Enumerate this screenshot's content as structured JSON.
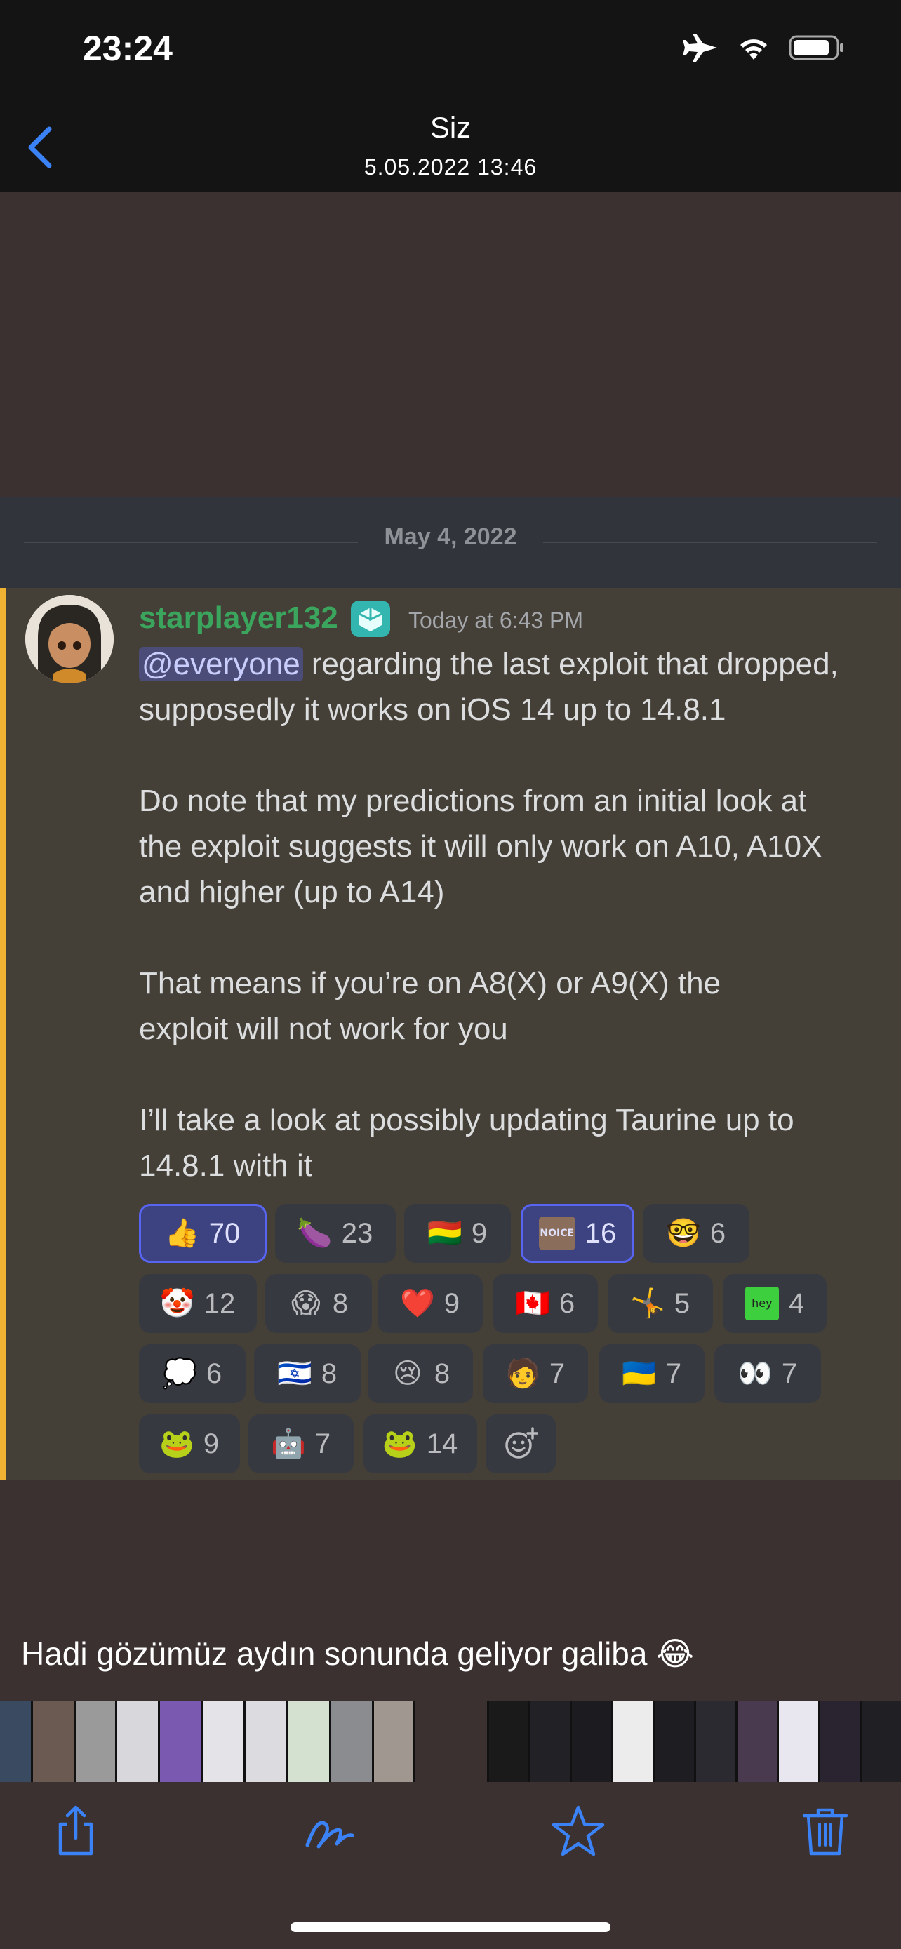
{
  "status_bar": {
    "time": "23:24",
    "icons": [
      "airplane-icon",
      "wifi-icon",
      "battery-icon"
    ]
  },
  "nav": {
    "title": "Siz",
    "subtitle": "5.05.2022 13:46",
    "back_icon": "chevron-left-icon",
    "accent_color": "#3b82f6"
  },
  "screenshot": {
    "date_divider": "May 4, 2022",
    "message": {
      "author": "starplayer132",
      "timestamp": "Today at 6:43 PM",
      "mention": "@everyone",
      "text_after_mention": " regarding the last exploit that dropped,\nsupposedly it works on iOS 14 up to 14.8.1\n\nDo note that my predictions from an initial look at\nthe exploit suggests it will only work on A10, A10X\nand higher (up to A14)\n\nThat means if you’re on A8(X) or A9(X) the\nexploit will not work for you\n\nI’ll take a look at possibly updating Taurine up to\n14.8.1 with it"
    },
    "reactions": [
      {
        "emoji": "👍",
        "count": "70",
        "active": true
      },
      {
        "emoji": "🍆",
        "count": "23",
        "active": false
      },
      {
        "emoji": "🇧🇴",
        "count": "9",
        "active": false
      },
      {
        "emoji": "NOICE",
        "count": "16",
        "active": true
      },
      {
        "emoji": "🤓",
        "count": "6",
        "active": false
      },
      {
        "emoji": "🤡",
        "count": "12",
        "active": false
      },
      {
        "emoji": "😱",
        "count": "8",
        "active": false
      },
      {
        "emoji": "❤️",
        "count": "9",
        "active": false
      },
      {
        "emoji": "🇨🇦",
        "count": "6",
        "active": false
      },
      {
        "emoji": "🤸",
        "count": "5",
        "active": false
      },
      {
        "emoji": "hey",
        "count": "4",
        "active": false
      },
      {
        "emoji": "💭",
        "count": "6",
        "active": false
      },
      {
        "emoji": "🇮🇱",
        "count": "8",
        "active": false
      },
      {
        "emoji": "😢",
        "count": "8",
        "active": false
      },
      {
        "emoji": "🧑",
        "count": "7",
        "active": false
      },
      {
        "emoji": "🇺🇦",
        "count": "7",
        "active": false
      },
      {
        "emoji": "👀",
        "count": "7",
        "active": false
      },
      {
        "emoji": "🐸",
        "count": "9",
        "active": false
      },
      {
        "emoji": "🤖",
        "count": "7",
        "active": false
      },
      {
        "emoji": "🐸",
        "count": "14",
        "active": false
      }
    ],
    "add_reaction_icon": "add-reaction-icon"
  },
  "caption": "Hadi gözümüz aydın sonunda geliyor galiba 😂",
  "toolbar": {
    "icons": [
      "share-icon",
      "markup-icon",
      "favorite-star-icon",
      "trash-icon"
    ]
  }
}
